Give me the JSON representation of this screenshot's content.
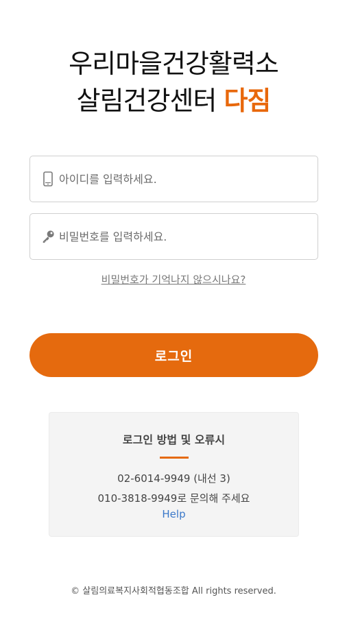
{
  "title": {
    "line1": "우리마을건강활력소",
    "line2_main": "살림건강센터 ",
    "line2_accent": "다짐"
  },
  "login_form": {
    "id_placeholder": "아이디를 입력하세요.",
    "pw_placeholder": "비밀번호를 입력하세요.",
    "id_icon": "phone-icon",
    "pw_icon": "key-icon",
    "forgot_label": "비밀번호가 기억나지 않으시나요?",
    "login_label": "로그인"
  },
  "help_box": {
    "title": "로그인 방법 및 오류시",
    "line1": "02-6014-9949 (내선 3)",
    "line2": "010-3818-9949로 문의해 주세요",
    "link": "Help"
  },
  "footer": {
    "copyright": "© 살림의료복지사회적협동조합 All rights reserved."
  },
  "colors": {
    "accent": "#e56a0e",
    "link": "#3a78c9"
  }
}
